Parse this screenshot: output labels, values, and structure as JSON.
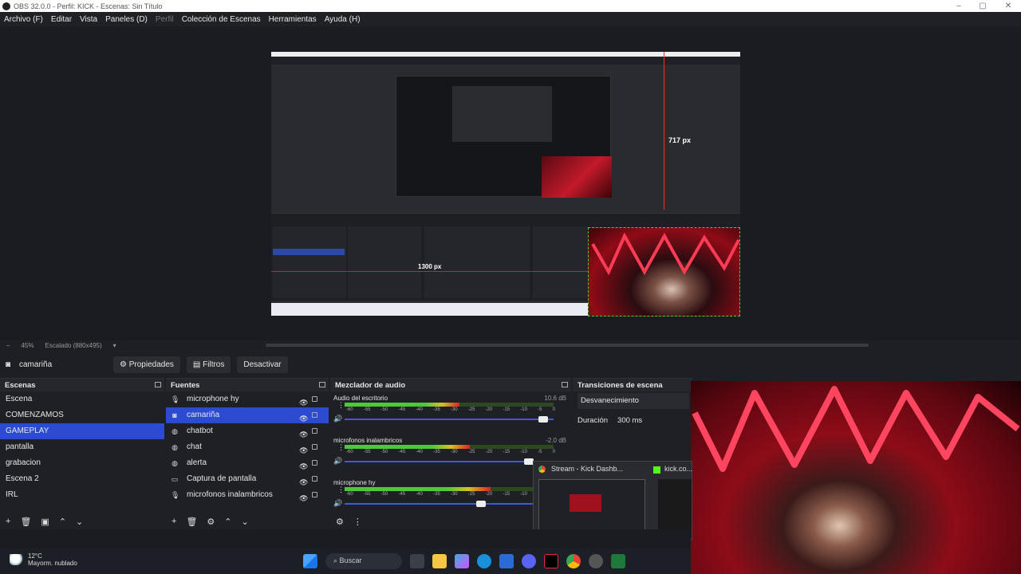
{
  "window": {
    "title": "OBS 32.0.0 - Perfil: KICK - Escenas: Sin Título"
  },
  "menu": [
    "Archivo (F)",
    "Editar",
    "Vista",
    "Paneles (D)",
    "Perfil",
    "Colección de Escenas",
    "Herramientas",
    "Ayuda (H)"
  ],
  "preview": {
    "guide_v_label": "717 px",
    "guide_h_label": "1300 px",
    "zoom": "45%",
    "scaling": "Escalado (880x495)"
  },
  "source_toolbar": {
    "source_name": "camariña",
    "properties": "Propiedades",
    "filters": "Filtros",
    "deactivate": "Desactivar"
  },
  "scenes": {
    "title": "Escenas",
    "items": [
      "Escena",
      "COMENZAMOS",
      "GAMEPLAY",
      "pantalla",
      "grabacion",
      "Escena 2",
      "IRL"
    ],
    "selected": "GAMEPLAY"
  },
  "sources": {
    "title": "Fuentes",
    "items": [
      {
        "name": "microphone hy",
        "icon": "microphone-icon"
      },
      {
        "name": "camariña",
        "icon": "camera-icon"
      },
      {
        "name": "chatbot",
        "icon": "globe-icon"
      },
      {
        "name": "chat",
        "icon": "globe-icon"
      },
      {
        "name": "alerta",
        "icon": "globe-icon"
      },
      {
        "name": "Captura de pantalla",
        "icon": "monitor-icon"
      },
      {
        "name": "microfonos inalambricos",
        "icon": "microphone-icon"
      }
    ]
  },
  "mixer": {
    "title": "Mezclador de audio",
    "ticks": [
      "-60",
      "-55",
      "-50",
      "-45",
      "-40",
      "-35",
      "-30",
      "-25",
      "-20",
      "-15",
      "-10",
      "-5",
      "0"
    ],
    "channels": [
      {
        "name": "Audio del escritorio",
        "db": "10.6 dB",
        "level": 0.55,
        "volume": 0.97
      },
      {
        "name": "microfonos inalambricos",
        "db": "-2.0 dB",
        "level": 0.6,
        "volume": 0.9
      },
      {
        "name": "microphone hy",
        "db": "",
        "level": 0.7,
        "volume": 0.66
      }
    ]
  },
  "transitions": {
    "title": "Transiciones de escena",
    "selected": "Desvanecimiento",
    "duration_label": "Duración",
    "duration_value": "300 ms"
  },
  "taskbar_popup": {
    "tab1": "Stream - Kick Dashb...",
    "tab2": "kick.co..."
  },
  "taskbar": {
    "temp": "12°C",
    "weather": "Mayorm. nublado",
    "search": "Buscar"
  },
  "colors": {
    "accent": "#2c4bd1",
    "guide": "#ff2a2a",
    "kick": "#53fc18"
  }
}
